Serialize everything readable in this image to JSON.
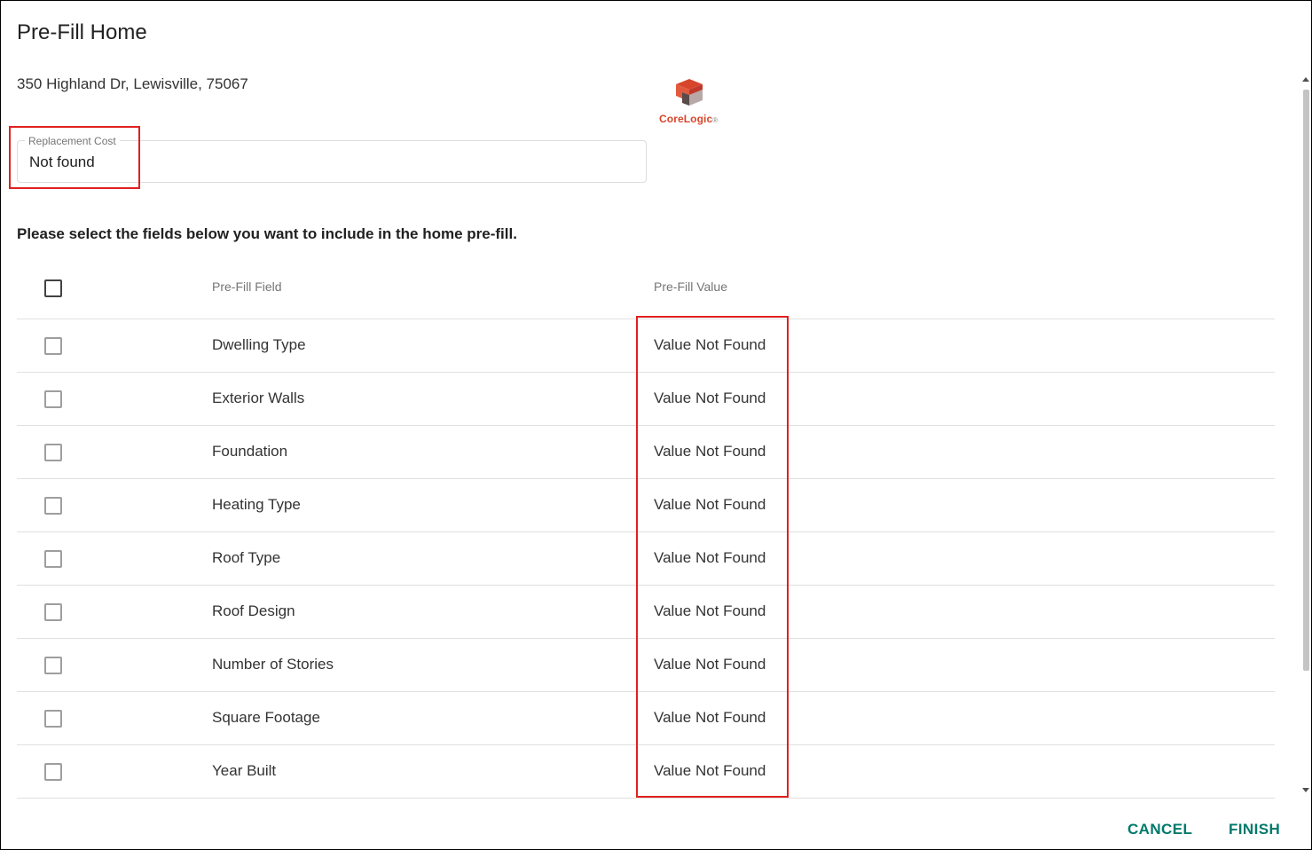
{
  "dialog": {
    "title": "Pre-Fill Home",
    "address": "350 Highland Dr, Lewisville, 75067"
  },
  "logo": {
    "text": "CoreLogic",
    "mark": "®",
    "icon": "corelogic-cube-icon",
    "colors": {
      "red": "#d7462b",
      "dark": "#5a4a4a",
      "gray": "#b8a8a8"
    }
  },
  "replacement_cost": {
    "label": "Replacement Cost",
    "value": "Not found"
  },
  "instructions": "Please select the fields below you want to include in the home pre-fill.",
  "table": {
    "headers": {
      "field": "Pre-Fill Field",
      "value": "Pre-Fill Value"
    },
    "rows": [
      {
        "field": "Dwelling Type",
        "value": "Value Not Found",
        "checked": false
      },
      {
        "field": "Exterior Walls",
        "value": "Value Not Found",
        "checked": false
      },
      {
        "field": "Foundation",
        "value": "Value Not Found",
        "checked": false
      },
      {
        "field": "Heating Type",
        "value": "Value Not Found",
        "checked": false
      },
      {
        "field": "Roof Type",
        "value": "Value Not Found",
        "checked": false
      },
      {
        "field": "Roof Design",
        "value": "Value Not Found",
        "checked": false
      },
      {
        "field": "Number of Stories",
        "value": "Value Not Found",
        "checked": false
      },
      {
        "field": "Square Footage",
        "value": "Value Not Found",
        "checked": false
      },
      {
        "field": "Year Built",
        "value": "Value Not Found",
        "checked": false
      }
    ]
  },
  "footer": {
    "cancel_label": "CANCEL",
    "finish_label": "FINISH",
    "accent_color": "#00796b"
  },
  "annotation_color": "#e02020"
}
